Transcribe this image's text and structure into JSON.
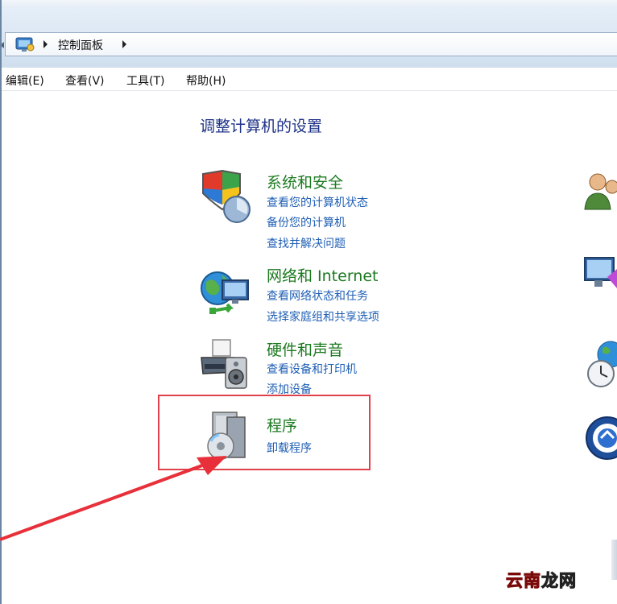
{
  "address_bar": {
    "crumb": "控制面板"
  },
  "menu": [
    {
      "label": "编辑(E)"
    },
    {
      "label": "查看(V)"
    },
    {
      "label": "工具(T)"
    },
    {
      "label": "帮助(H)"
    }
  ],
  "page_title": "调整计算机的设置",
  "categories": [
    {
      "title": "系统和安全",
      "icon": "shield-icon",
      "links": [
        "查看您的计算机状态",
        "备份您的计算机",
        "查找并解决问题"
      ]
    },
    {
      "title": "网络和 Internet",
      "icon": "globe-network-icon",
      "links": [
        "查看网络状态和任务",
        "选择家庭组和共享选项"
      ]
    },
    {
      "title": "硬件和声音",
      "icon": "printer-speaker-icon",
      "links": [
        "查看设备和打印机",
        "添加设备"
      ]
    },
    {
      "title": "程序",
      "icon": "programs-disc-icon",
      "links": [
        "卸载程序"
      ]
    }
  ],
  "right_column_icons": [
    "user-accounts-icon",
    "appearance-icon",
    "clock-globe-icon",
    "ease-of-access-icon"
  ],
  "watermark": {
    "part1": "云南",
    "part2": "龙网"
  },
  "colors": {
    "category_title": "#1c7a20",
    "link": "#1f5fb4",
    "page_title": "#1e3287",
    "highlight": "#e0404a",
    "arrow": "#e8303a"
  }
}
